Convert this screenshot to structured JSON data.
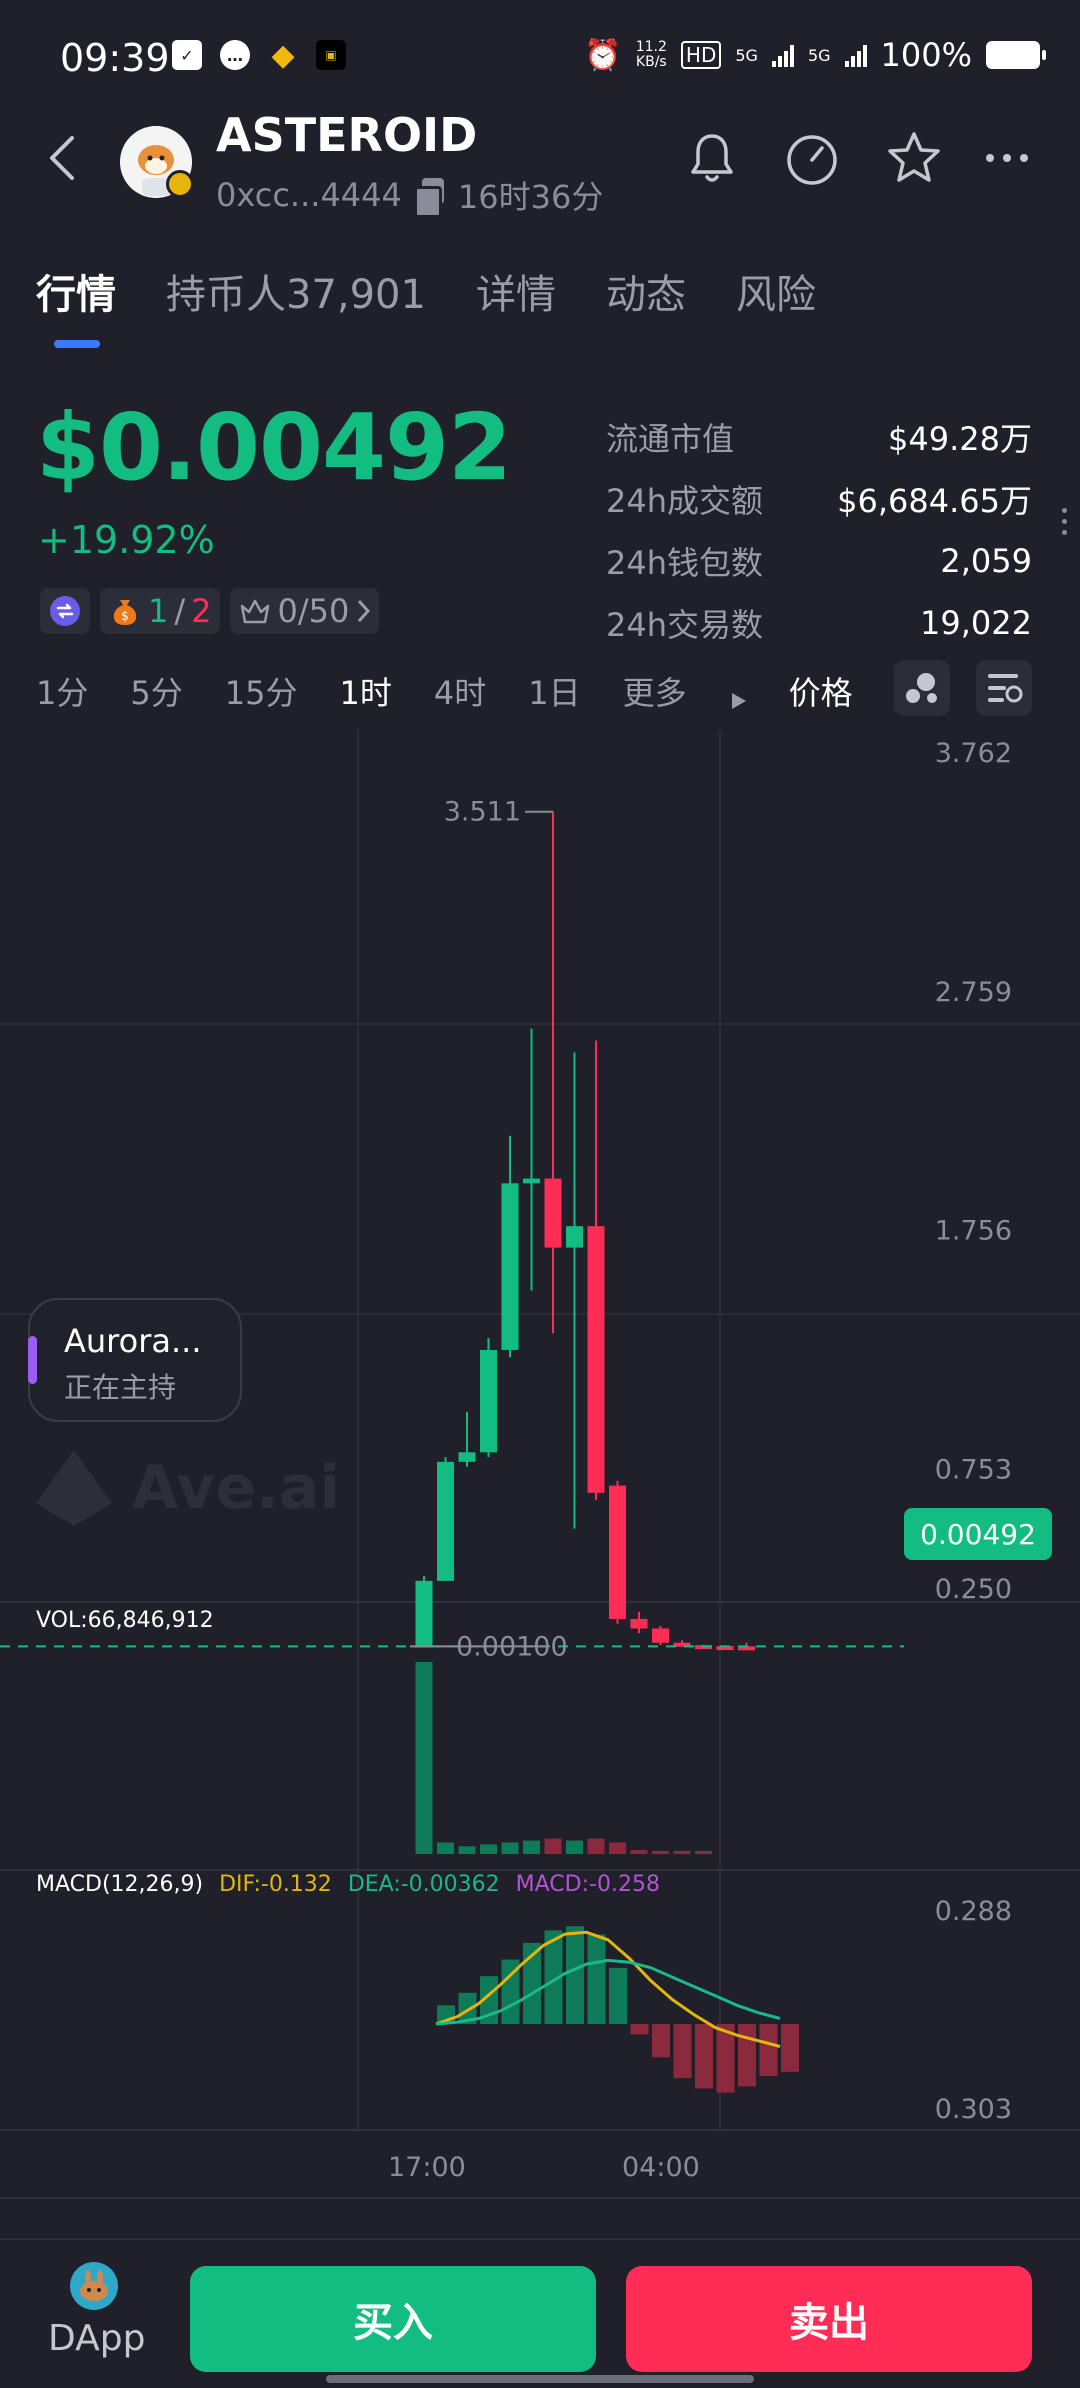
{
  "status": {
    "time": "09:39",
    "net_speed_top": "11.2",
    "net_speed_unit": "KB/s",
    "hd_badge": "HD",
    "signal1": "5G",
    "signal2": "5G",
    "battery": "100%"
  },
  "header": {
    "title": "ASTEROID",
    "address": "0xcc...4444",
    "age": "16时36分"
  },
  "tabs": [
    {
      "label": "行情",
      "active": true
    },
    {
      "label": "持币人37,901"
    },
    {
      "label": "详情"
    },
    {
      "label": "动态"
    },
    {
      "label": "风险"
    }
  ],
  "price": {
    "value": "$0.00492",
    "change": "+19.92%"
  },
  "chips": {
    "tax_green": "1",
    "tax_sep": "/",
    "tax_red": "2",
    "top_holders": "0/50"
  },
  "stats": [
    {
      "label": "流通市值",
      "value": "$49.28万"
    },
    {
      "label": "24h成交额",
      "value": "$6,684.65万"
    },
    {
      "label": "24h钱包数",
      "value": "2,059"
    },
    {
      "label": "24h交易数",
      "value": "19,022"
    }
  ],
  "timeframes": [
    "1分",
    "5分",
    "15分",
    "1时",
    "4时",
    "1日",
    "更多",
    "价格"
  ],
  "timeframe_active": "1时",
  "host": {
    "title": "Aurora...",
    "subtitle": "正在主持"
  },
  "watermark": "Ave.ai",
  "current_price_tag": "0.00492",
  "chart_data": {
    "type": "candlestick",
    "y_axis_labels": [
      "3.762",
      "2.759",
      "1.756",
      "0.753",
      "0.250"
    ],
    "max_label": "3.511",
    "min_label": "0.00100",
    "x_axis_labels": [
      "17:00",
      "04:00"
    ],
    "candles": [
      {
        "o": 0.0,
        "c": 0.28,
        "h": 0.3,
        "l": 0.0,
        "dir": "up"
      },
      {
        "o": 0.28,
        "c": 0.78,
        "h": 0.8,
        "l": 0.28,
        "dir": "up"
      },
      {
        "o": 0.78,
        "c": 0.82,
        "h": 0.99,
        "l": 0.76,
        "dir": "up"
      },
      {
        "o": 0.82,
        "c": 1.25,
        "h": 1.3,
        "l": 0.8,
        "dir": "up"
      },
      {
        "o": 1.25,
        "c": 1.95,
        "h": 2.15,
        "l": 1.22,
        "dir": "up"
      },
      {
        "o": 1.95,
        "c": 1.97,
        "h": 2.6,
        "l": 1.5,
        "dir": "up"
      },
      {
        "o": 1.97,
        "c": 1.68,
        "h": 3.511,
        "l": 1.32,
        "dir": "down"
      },
      {
        "o": 1.68,
        "c": 1.77,
        "h": 2.5,
        "l": 0.5,
        "dir": "up"
      },
      {
        "o": 1.77,
        "c": 0.65,
        "h": 2.55,
        "l": 0.62,
        "dir": "down"
      },
      {
        "o": 0.68,
        "c": 0.12,
        "h": 0.7,
        "l": 0.1,
        "dir": "down"
      },
      {
        "o": 0.12,
        "c": 0.08,
        "h": 0.15,
        "l": 0.06,
        "dir": "down"
      },
      {
        "o": 0.08,
        "c": 0.02,
        "h": 0.09,
        "l": 0.01,
        "dir": "down"
      },
      {
        "o": 0.02,
        "c": 0.01,
        "h": 0.03,
        "l": 0.005,
        "dir": "down"
      },
      {
        "o": 0.01,
        "c": 0.006,
        "h": 0.012,
        "l": 0.004,
        "dir": "down"
      },
      {
        "o": 0.006,
        "c": 0.005,
        "h": 0.01,
        "l": 0.004,
        "dir": "down"
      },
      {
        "o": 0.005,
        "c": 0.00492,
        "h": 0.02,
        "l": 0.004,
        "dir": "down"
      }
    ],
    "volume": {
      "label": "VOL:66,846,912",
      "bars": [
        {
          "v": 100,
          "dir": "up"
        },
        {
          "v": 6,
          "dir": "up"
        },
        {
          "v": 4,
          "dir": "up"
        },
        {
          "v": 5,
          "dir": "up"
        },
        {
          "v": 6,
          "dir": "up"
        },
        {
          "v": 7,
          "dir": "up"
        },
        {
          "v": 8,
          "dir": "down"
        },
        {
          "v": 7,
          "dir": "up"
        },
        {
          "v": 8,
          "dir": "down"
        },
        {
          "v": 6,
          "dir": "down"
        },
        {
          "v": 2,
          "dir": "down"
        },
        {
          "v": 1,
          "dir": "down"
        },
        {
          "v": 1,
          "dir": "down"
        },
        {
          "v": 1,
          "dir": "down"
        }
      ]
    },
    "macd": {
      "label": "MACD(12,26,9)",
      "dif_label": "DIF:-0.132",
      "dea_label": "DEA:-0.00362",
      "macd_label": "MACD:-0.258",
      "axis_labels": [
        "0.288",
        "0.303"
      ],
      "hist": [
        0.18,
        0.3,
        0.46,
        0.62,
        0.78,
        0.9,
        0.94,
        0.86,
        0.54,
        -0.1,
        -0.32,
        -0.52,
        -0.62,
        -0.66,
        -0.6,
        -0.5,
        -0.46
      ],
      "dif": [
        0.0,
        0.08,
        0.22,
        0.42,
        0.64,
        0.84,
        0.96,
        0.98,
        0.9,
        0.7,
        0.46,
        0.26,
        0.1,
        -0.04,
        -0.12,
        -0.18,
        -0.24
      ],
      "dea": [
        0.0,
        0.02,
        0.06,
        0.14,
        0.26,
        0.4,
        0.54,
        0.64,
        0.68,
        0.66,
        0.6,
        0.5,
        0.4,
        0.3,
        0.2,
        0.12,
        0.06
      ]
    }
  },
  "colors": {
    "up": "#13bd81",
    "down": "#ff2d55",
    "dif": "#e3b50f",
    "dea": "#1ab88a",
    "macd": "#b553d6",
    "accent": "#3a7bfd"
  },
  "bottom": {
    "dapp_label": "DApp",
    "buy_label": "买入",
    "sell_label": "卖出"
  }
}
